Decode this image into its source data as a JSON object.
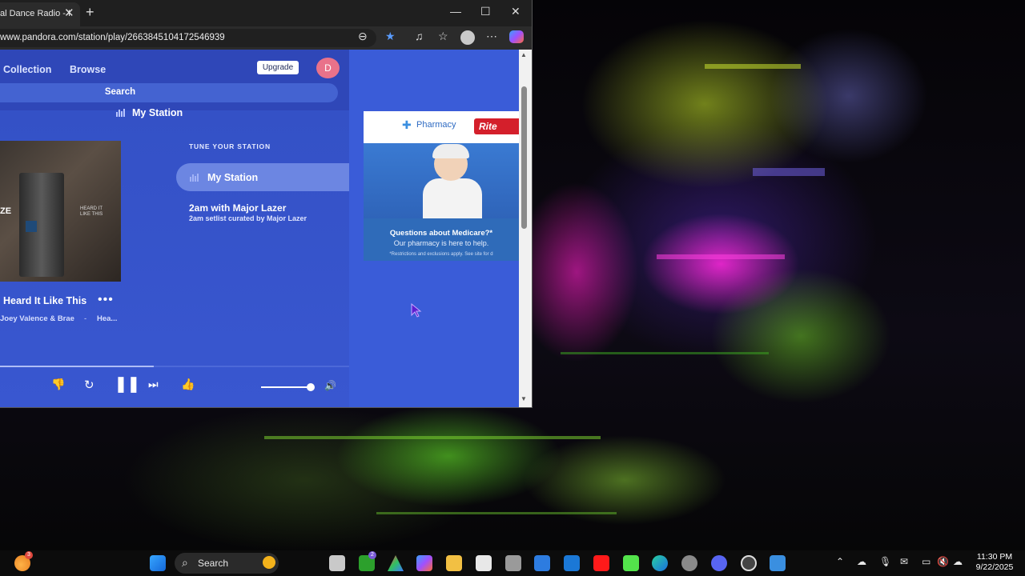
{
  "browser": {
    "tab_title": "al Dance Radio - I",
    "tab_close": "✕",
    "new_tab": "+",
    "url": "www.pandora.com/station/play/2663845104172546939",
    "window_controls": {
      "minimize": "—",
      "maximize": "☐",
      "close": "✕"
    }
  },
  "pandora": {
    "nav": {
      "collection": "Collection",
      "browse": "Browse"
    },
    "upgrade": "Upgrade",
    "avatar_initial": "D",
    "search": "Search",
    "station_header": "My Station",
    "album": {
      "left_text": "ZE",
      "right_text": "HEARD IT LIKE THIS"
    },
    "now_playing": {
      "title": "Heard It Like This",
      "more": "•••",
      "artist": "Joey Valence & Brae",
      "separator": "-",
      "album": "Hea..."
    },
    "tune_label": "TUNE YOUR STATION",
    "stations": [
      {
        "title": "My Station"
      },
      {
        "title": "2am with Major Lazer",
        "subtitle": "2am setlist curated by Major Lazer"
      }
    ],
    "playback_progress": 0.44,
    "volume_level": 0.94
  },
  "ad": {
    "pharmacy": "Pharmacy",
    "brand": "Rite",
    "question": "Questions about Medicare?*",
    "subtitle": "Our pharmacy is here to help.",
    "fine_print": "*Restrictions and exclusions apply. See site for d"
  },
  "taskbar": {
    "search": "Search",
    "time": "11:30 PM",
    "date": "9/22/2025",
    "weather_badge": "3",
    "xbox_badge": "2"
  },
  "colors": {
    "pandora_blue": "#3854c8",
    "station_highlight": "#6c86e2",
    "avatar": "#e9728a"
  }
}
